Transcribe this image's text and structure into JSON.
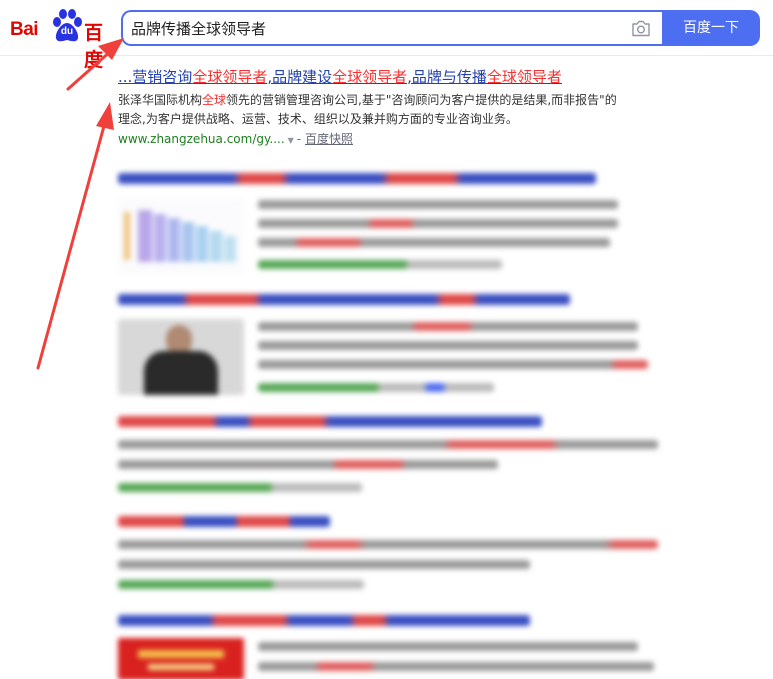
{
  "header": {
    "logo_text_latin": "Bai",
    "logo_paw_text": "du",
    "logo_text_cn": "百度",
    "search_query": "品牌传播全球领导者",
    "search_button_label": "百度一下",
    "camera_icon": "camera-icon"
  },
  "results": [
    {
      "title_parts": [
        "...营销咨询",
        "全球领导者",
        ",品牌建设",
        "全球领导者",
        ",品牌与传播",
        "全球领导者"
      ],
      "abstract_line1_a": "张泽华国际机构",
      "abstract_line1_em": "全球",
      "abstract_line1_b": "领先的营销管理咨询公司,基于\"咨询顾问为客户提供的是结果,而非报告\"的",
      "abstract_line2": "理念,为客户提供战略、运营、技术、组织以及兼并购方面的专业咨询业务。",
      "url": "www.zhangzehua.com/gy....",
      "snapshot_label": "百度快照"
    }
  ],
  "colors": {
    "brand_red": "#e10601",
    "brand_blue": "#4e6ef2",
    "link_blue": "#2440b3",
    "highlight_red": "#f73131",
    "url_green": "#1e7f1e",
    "annotation_arrow": "#f0403c"
  }
}
